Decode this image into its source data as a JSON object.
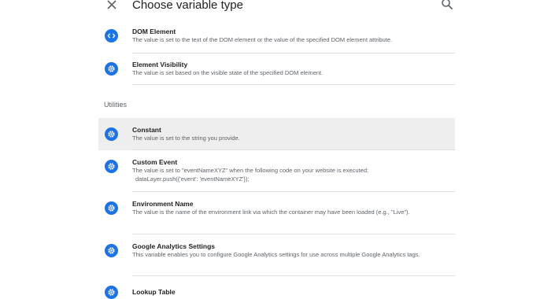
{
  "header": {
    "title": "Choose variable type",
    "close_icon": "close-icon",
    "search_icon": "search-icon"
  },
  "accent_color": "#1a73e8",
  "section": {
    "utilities": "Utilities"
  },
  "items": [
    {
      "name": "DOM Element",
      "icon": "code-icon",
      "desc": "The value is set to the text of the DOM element or the value of the specified DOM element attribute."
    },
    {
      "name": "Element Visibility",
      "icon": "gear-icon",
      "desc": "The value is set based on the visible state of the specified DOM element."
    },
    {
      "name": "Constant",
      "icon": "gear-icon",
      "desc": "The value is set to the string you provide."
    },
    {
      "name": "Custom Event",
      "icon": "gear-icon",
      "desc": "The value is set to \"eventNameXYZ\" when the following code on your website is executed:",
      "code": "dataLayer.push({'event': 'eventNameXYZ'});"
    },
    {
      "name": "Environment Name",
      "icon": "gear-icon",
      "desc": "The value is the name of the environment link via which the container may have been loaded (e.g., \"Live\")."
    },
    {
      "name": "Google Analytics Settings",
      "icon": "gear-icon",
      "desc": "This variable enables you to configure Google Analytics settings for use across multiple Google Analytics tags."
    },
    {
      "name": "Lookup Table",
      "icon": "gear-icon",
      "desc": ""
    }
  ]
}
